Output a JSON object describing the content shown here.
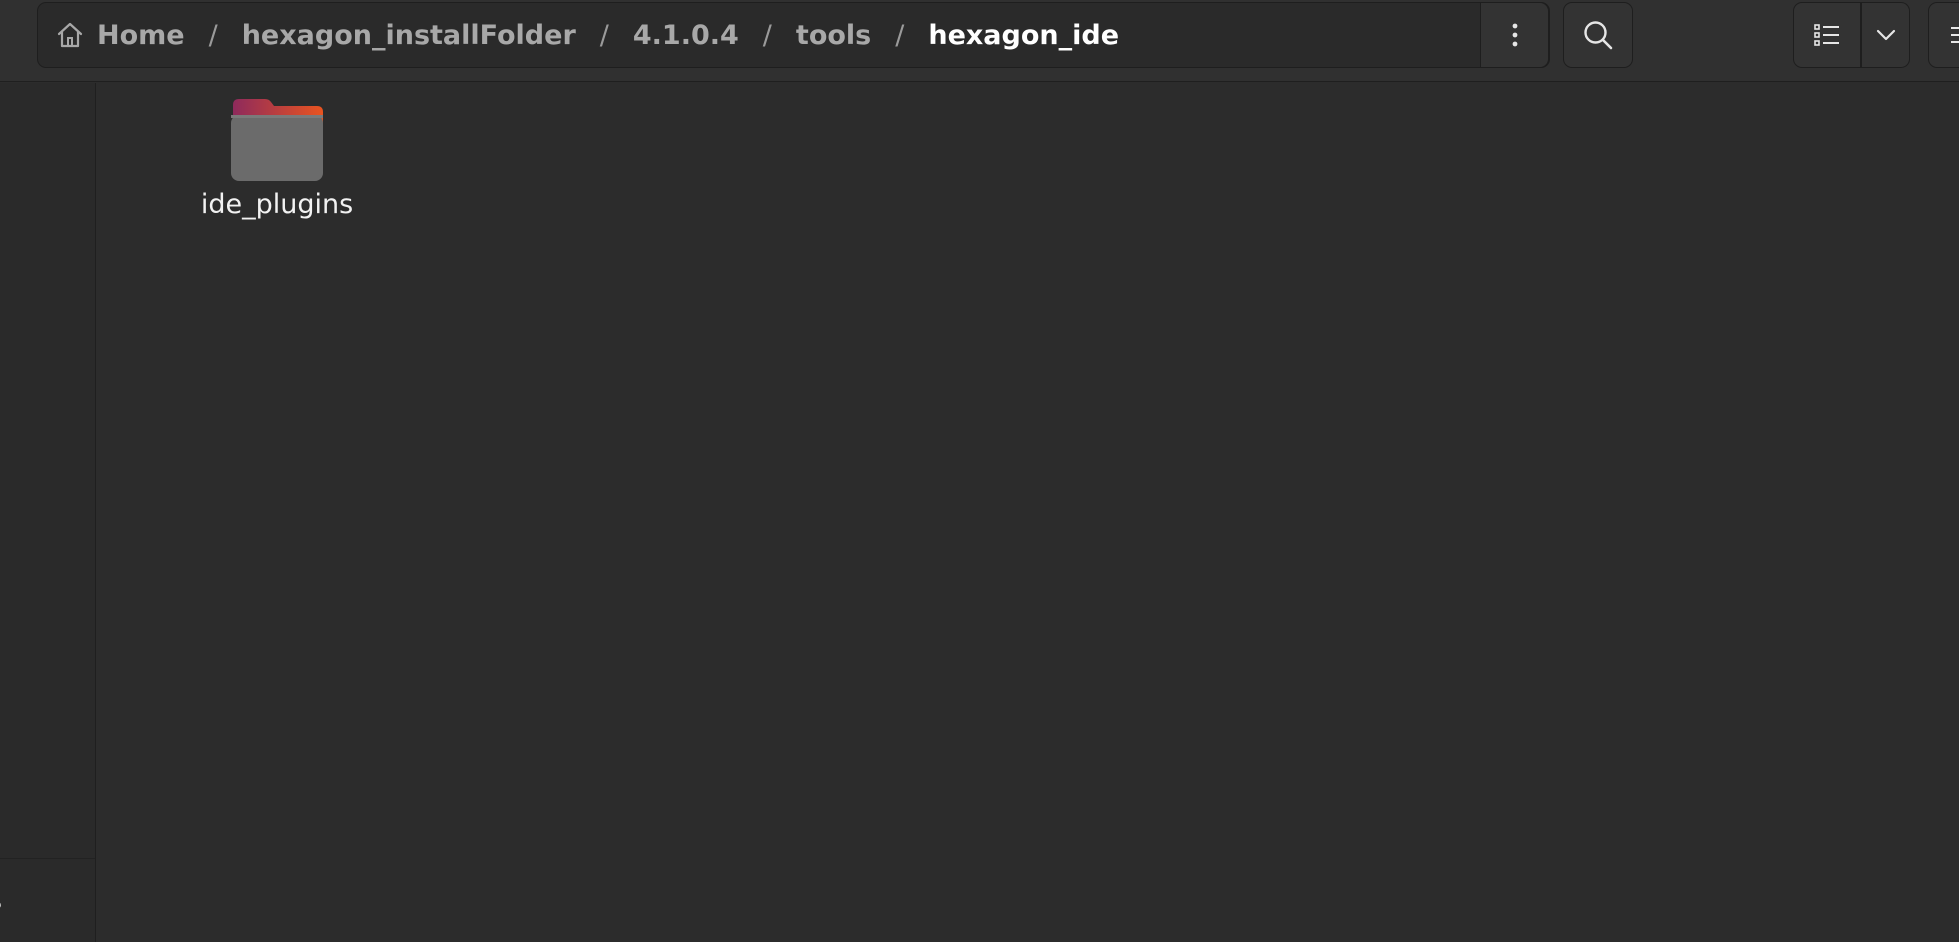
{
  "pathbar": {
    "crumbs": [
      {
        "label": "Home"
      },
      {
        "label": "hexagon_installFolder"
      },
      {
        "label": "4.1.0.4"
      },
      {
        "label": "tools"
      },
      {
        "label": "hexagon_ide"
      }
    ],
    "separator": "/"
  },
  "sidebar": {
    "bottom_label_fragment": "s"
  },
  "files": [
    {
      "name": "ide_plugins",
      "type": "folder"
    }
  ],
  "icons": {
    "home": "home-icon",
    "path_menu": "vertical-dots-icon",
    "search": "search-icon",
    "view": "list-view-icon",
    "view_dropdown": "chevron-down-icon",
    "menu": "hamburger-icon",
    "folder": "folder-icon"
  },
  "colors": {
    "background": "#2c2c2c",
    "headerbar": "#303030",
    "folder_body": "#6b6b6b",
    "folder_tab_start": "#8e2a5c",
    "folder_tab_end": "#e95420",
    "breadcrumb_inactive": "#a8a8a8",
    "breadcrumb_active": "#ffffff"
  }
}
